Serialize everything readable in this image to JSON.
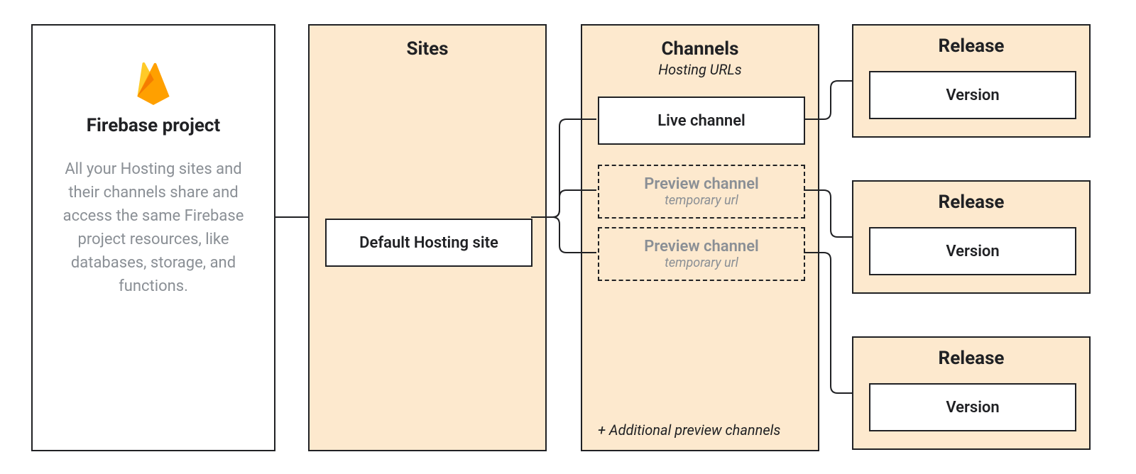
{
  "project": {
    "title": "Firebase project",
    "description": "All your Hosting sites and their channels share and access the same Firebase project resources, like databases, storage, and functions."
  },
  "sites": {
    "title": "Sites",
    "default_label": "Default Hosting site"
  },
  "channels": {
    "title": "Channels",
    "subtitle": "Hosting URLs",
    "live_label": "Live channel",
    "preview1_label": "Preview channel",
    "preview1_sub": "temporary url",
    "preview2_label": "Preview channel",
    "preview2_sub": "temporary url",
    "footer": "+ Additional preview channels"
  },
  "releases": {
    "r1_title": "Release",
    "r1_version": "Version",
    "r2_title": "Release",
    "r2_version": "Version",
    "r3_title": "Release",
    "r3_version": "Version"
  },
  "icons": {
    "firebase": "firebase-icon"
  }
}
